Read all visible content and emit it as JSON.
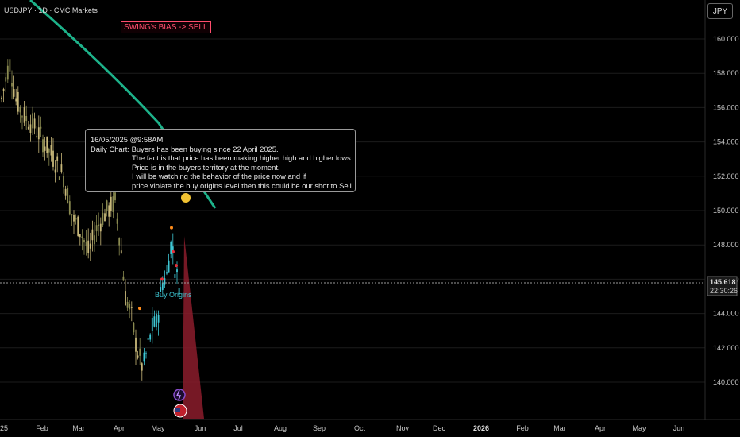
{
  "header": {
    "symbol": "USDJPY · 1D · CMC Markets",
    "currency_button": "JPY"
  },
  "bias_label": "SWING's BIAS -> SELL",
  "note": {
    "date": "16/05/2025 @9:58AM",
    "line1": "Daily Chart: Buyers has been buying since 22 April 2025.",
    "line2": "The fact is that price has been making higher high and higher lows.",
    "line3": "Price is in the buyers territory at the moment.",
    "line4": "I will be watching the behavior of the price now and if",
    "line5": "price violate the buy origins level then this could be our shot to Sell"
  },
  "zone_label": "Buy Origins",
  "last_price": {
    "value": "145.618",
    "countdown": "22:30:26"
  },
  "colors": {
    "background": "#000000",
    "candle_up": "#c8b87a",
    "candle_down": "#8a8a50",
    "highlight": "#3ec7d4",
    "curve": "#1db28a",
    "sell_zone": "#8b1c2c",
    "bias_text": "#ff4d6d"
  },
  "chart_data": {
    "type": "candlestick",
    "title": "USDJPY · 1D · CMC Markets",
    "xlabel": "",
    "ylabel": "",
    "x_ticks": [
      "25",
      "Feb",
      "Mar",
      "Apr",
      "May",
      "Jun",
      "Jul",
      "Aug",
      "Sep",
      "Oct",
      "Nov",
      "Dec",
      "2026",
      "Feb",
      "Mar",
      "Apr",
      "May",
      "Jun"
    ],
    "y_ticks": [
      "140.000",
      "142.000",
      "144.000",
      "146.000",
      "148.000",
      "150.000",
      "152.000",
      "154.000",
      "156.000",
      "158.000",
      "160.000"
    ],
    "ylim": [
      138.8,
      161.2
    ],
    "last_price": 145.618,
    "annotations": [
      "SWING's BIAS -> SELL",
      "Buy Origins"
    ],
    "trend_hint": "decline from ~158.9 in Jan to ~139.9 low in late Apr, rebound to ~148.6 in mid-May"
  }
}
